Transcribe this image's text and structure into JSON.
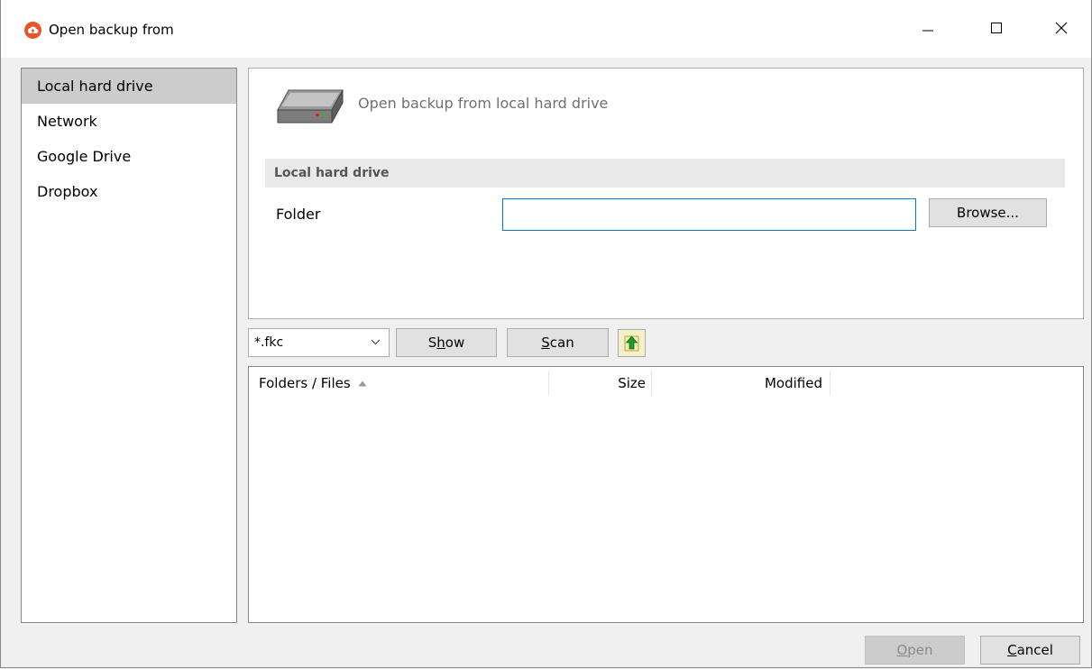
{
  "window": {
    "title": "Open backup from",
    "icon": "cloud-upload-icon"
  },
  "nav": {
    "items": [
      {
        "label": "Local hard drive",
        "selected": true
      },
      {
        "label": "Network",
        "selected": false
      },
      {
        "label": "Google Drive",
        "selected": false
      },
      {
        "label": "Dropbox",
        "selected": false
      }
    ]
  },
  "panel": {
    "icon": "hard-drive-icon",
    "caption": "Open backup from local hard drive",
    "section_title": "Local hard drive",
    "folder_label": "Folder",
    "folder_value": "",
    "browse_label": "Browse..."
  },
  "toolbar": {
    "filter_value": "*.fkc",
    "show_label_pre": "S",
    "show_label_accel": "h",
    "show_label_post": "ow",
    "scan_label_accel": "S",
    "scan_label_post": "can",
    "up_icon": "folder-up-icon"
  },
  "list": {
    "columns": {
      "name": "Folders / Files",
      "size": "Size",
      "modified": "Modified"
    },
    "sort": "ascending",
    "rows": []
  },
  "footer": {
    "open_accel": "O",
    "open_post": "pen",
    "cancel_accel": "C",
    "cancel_post": "ancel"
  },
  "colors": {
    "accent": "#0078d7",
    "app_icon": "#e8542b",
    "selected_nav": "#cccccc",
    "up_arrow": "#1a9a2a"
  }
}
